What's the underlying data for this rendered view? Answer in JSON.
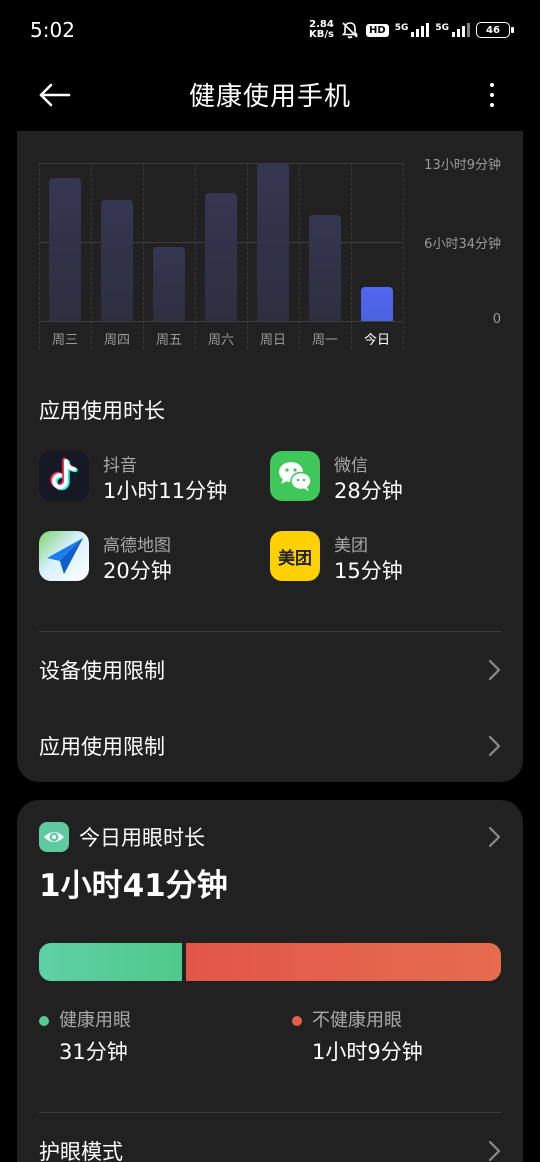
{
  "status": {
    "time": "5:02",
    "net_speed_value": "2.84",
    "net_speed_unit": "KB/s",
    "hd_label": "HD",
    "signal1_label": "5G",
    "signal2_label": "5G",
    "battery": "46"
  },
  "header": {
    "title": "健康使用手机"
  },
  "usage_chart": {
    "y_labels": [
      "13小时9分钟",
      "6小时34分钟",
      "0"
    ],
    "x_labels": [
      "周三",
      "周四",
      "周五",
      "周六",
      "周日",
      "周一",
      "今日"
    ]
  },
  "chart_data": {
    "type": "bar",
    "categories": [
      "周三",
      "周四",
      "周五",
      "周六",
      "周日",
      "周一",
      "今日"
    ],
    "values_minutes": [
      715,
      603,
      372,
      638,
      789,
      529,
      170
    ],
    "ylim_minutes": [
      0,
      789
    ],
    "y_tick_labels": [
      "0",
      "6小时34分钟",
      "13小时9分钟"
    ],
    "highlight_category": "今日",
    "colors": {
      "bar": "#33344a",
      "today": "#4f66ea"
    }
  },
  "app_usage": {
    "title": "应用使用时长",
    "apps": [
      {
        "name": "抖音",
        "time": "1小时11分钟",
        "icon": "douyin-icon"
      },
      {
        "name": "微信",
        "time": "28分钟",
        "icon": "wechat-icon"
      },
      {
        "name": "高德地图",
        "time": "20分钟",
        "icon": "amap-icon"
      },
      {
        "name": "美团",
        "time": "15分钟",
        "icon": "meituan-icon",
        "icon_text": "美团"
      }
    ]
  },
  "limits": {
    "device_limit": "设备使用限制",
    "app_limit": "应用使用限制"
  },
  "eye_care": {
    "title": "今日用眼时长",
    "total": "1小时41分钟",
    "healthy_label": "健康用眼",
    "healthy_value": "31分钟",
    "unhealthy_label": "不健康用眼",
    "unhealthy_value": "1小时9分钟",
    "healthy_minutes": 31,
    "unhealthy_minutes": 69,
    "eye_protection_mode": "护眼模式"
  },
  "colors": {
    "background": "#000000",
    "card": "#212121",
    "healthy": "#55cc94",
    "unhealthy": "#e45e4c",
    "today_bar": "#4f66ea"
  }
}
